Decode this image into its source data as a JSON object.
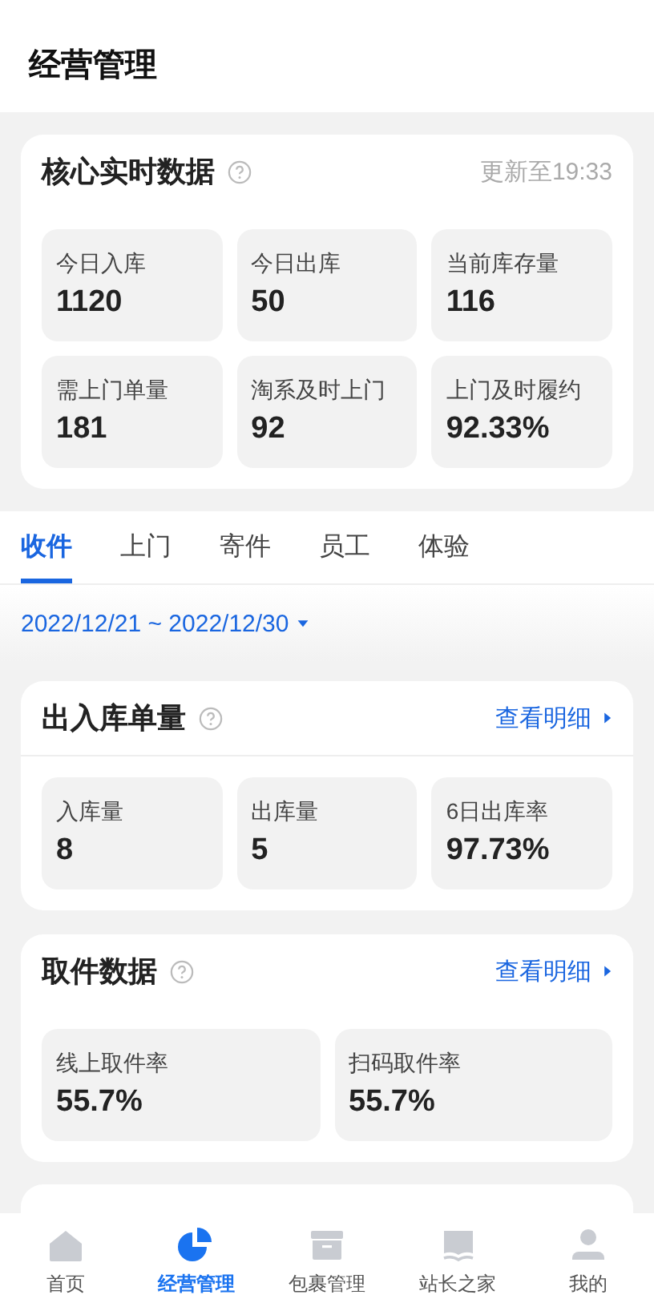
{
  "header": {
    "title": "经营管理"
  },
  "core": {
    "title": "核心实时数据",
    "updated": "更新至19:33",
    "metrics": [
      {
        "label": "今日入库",
        "value": "1120"
      },
      {
        "label": "今日出库",
        "value": "50"
      },
      {
        "label": "当前库存量",
        "value": "116"
      },
      {
        "label": "需上门单量",
        "value": "181"
      },
      {
        "label": "淘系及时上门",
        "value": "92"
      },
      {
        "label": "上门及时履约",
        "value": "92.33%"
      }
    ]
  },
  "tabs": [
    {
      "label": "收件",
      "selected": true
    },
    {
      "label": "上门",
      "selected": false
    },
    {
      "label": "寄件",
      "selected": false
    },
    {
      "label": "员工",
      "selected": false
    },
    {
      "label": "体验",
      "selected": false
    }
  ],
  "date_range": "2022/12/21 ~ 2022/12/30",
  "sections": [
    {
      "title": "出入库单量",
      "link": "查看明细",
      "divider": true,
      "metrics": [
        {
          "label": "入库量",
          "value": "8"
        },
        {
          "label": "出库量",
          "value": "5"
        },
        {
          "label": "6日出库率",
          "value": "97.73%"
        }
      ]
    },
    {
      "title": "取件数据",
      "link": "查看明细",
      "divider": false,
      "metrics": [
        {
          "label": "线上取件率",
          "value": "55.7%"
        },
        {
          "label": "扫码取件率",
          "value": "55.7%"
        }
      ]
    }
  ],
  "nav": [
    {
      "label": "首页",
      "selected": false
    },
    {
      "label": "经营管理",
      "selected": true
    },
    {
      "label": "包裹管理",
      "selected": false
    },
    {
      "label": "站长之家",
      "selected": false
    },
    {
      "label": "我的",
      "selected": false
    }
  ]
}
